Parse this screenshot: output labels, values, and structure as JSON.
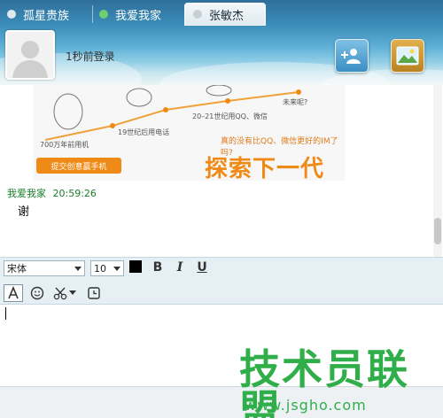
{
  "tabs": [
    {
      "label": "孤星贵族",
      "active": false
    },
    {
      "label": "我爱我家",
      "active": false
    },
    {
      "label": "张敏杰",
      "active": true
    }
  ],
  "header": {
    "status_text": "1秒前登录"
  },
  "banner": {
    "steps": [
      "700万年前用机",
      "19世纪后用电话",
      "20–21世纪用QQ、微信",
      "未来呢?"
    ],
    "question": "真的没有比QQ、微信更好的IM了吗?",
    "headline": "探索下一代IM",
    "cta": "提交创意赢手机"
  },
  "message": {
    "sender": "我爱我家",
    "time": "20:59:26",
    "text": "谢"
  },
  "format": {
    "font": "宋体",
    "size": "10",
    "bold": "B",
    "italic": "I",
    "underline": "U"
  },
  "watermark": {
    "title": "技术员联盟",
    "url": "www.jsgho.com"
  },
  "colors": {
    "accent": "#2fae4a",
    "banner": "#f08a16",
    "toolbar": "#e6f0f4"
  }
}
